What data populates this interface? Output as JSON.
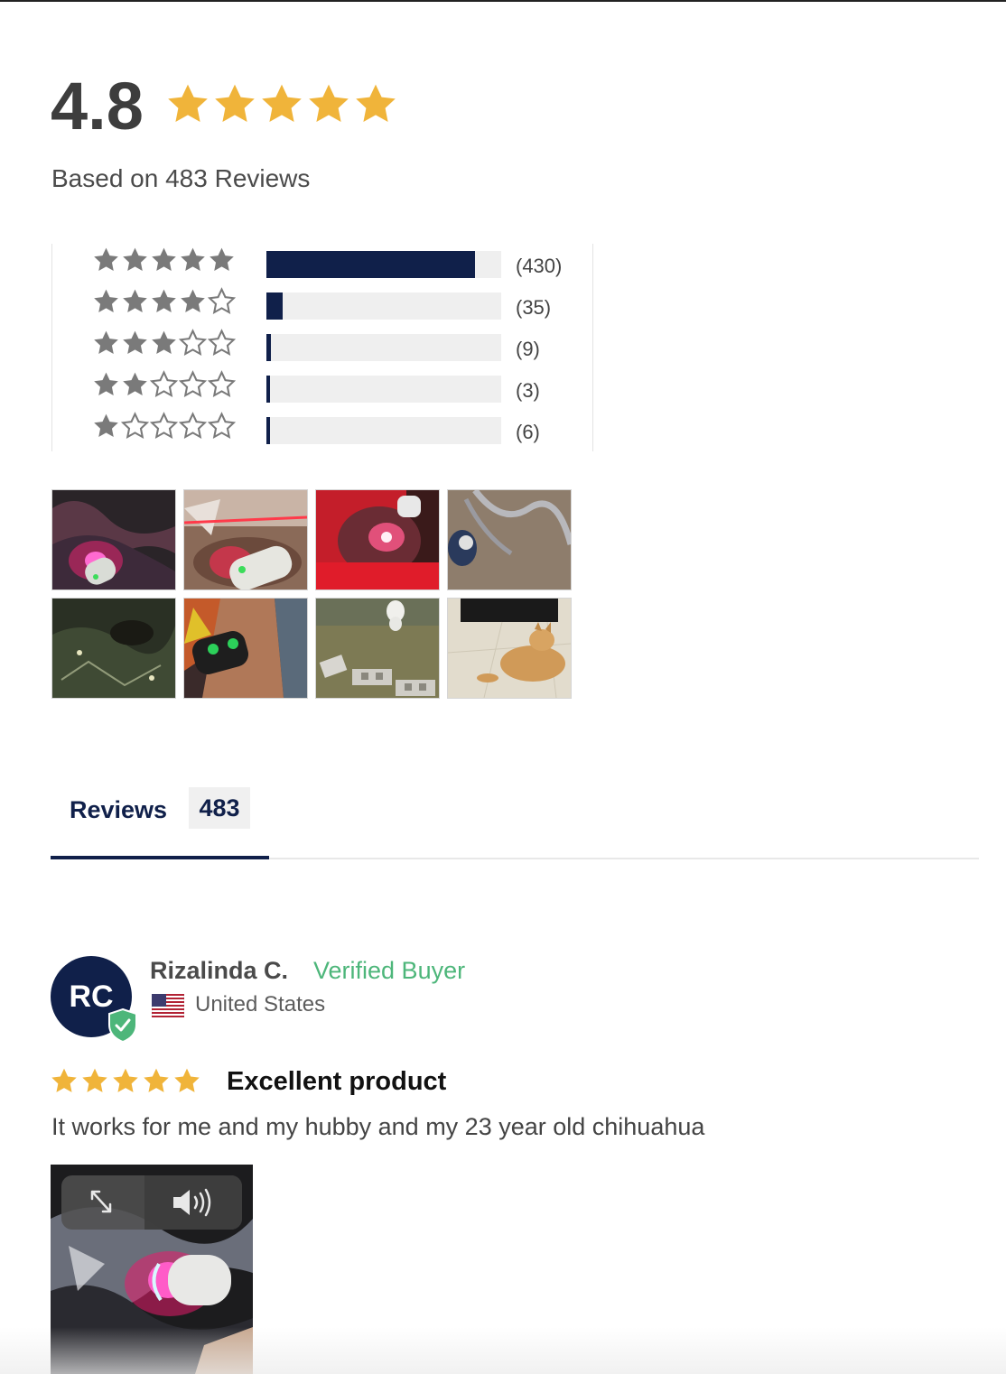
{
  "summary": {
    "average": "4.8",
    "average_stars_filled": 5,
    "based_on": "Based on 483 Reviews"
  },
  "histogram": [
    {
      "stars": 5,
      "fraction": 0.89,
      "count": "(430)"
    },
    {
      "stars": 4,
      "fraction": 0.07,
      "count": "(35)"
    },
    {
      "stars": 3,
      "fraction": 0.02,
      "count": "(9)"
    },
    {
      "stars": 2,
      "fraction": 0.01,
      "count": "(3)"
    },
    {
      "stars": 1,
      "fraction": 0.01,
      "count": "(6)"
    }
  ],
  "gallery": {
    "photo_count": 8
  },
  "tabs": {
    "reviews_label": "Reviews",
    "reviews_count": "483"
  },
  "review": {
    "initials": "RC",
    "name": "Rizalinda C.",
    "verified": "Verified Buyer",
    "country": "United States",
    "stars": 5,
    "title": "Excellent product",
    "body": "It works for me and my hubby and my 23 year old chihuahua"
  },
  "colors": {
    "star_gold": "#f0b43a",
    "star_gray": "#7a7a7a",
    "navy": "#10204a",
    "verified_green": "#4db67a"
  },
  "icons": {
    "video_expand": "expand-icon",
    "video_sound": "volume-icon",
    "verified_badge": "shield-check-icon"
  }
}
